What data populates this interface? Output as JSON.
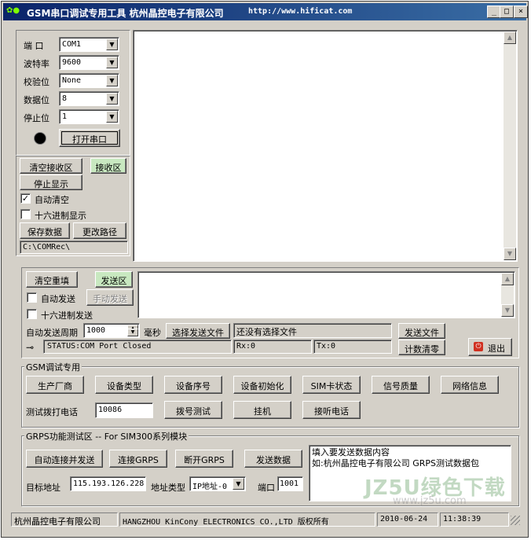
{
  "window": {
    "title": "GSM串口调试专用工具 杭州晶控电子有限公司",
    "title_url": "http://www.hificat.com",
    "minimize": "_",
    "maximize": "□",
    "close": "×"
  },
  "port": {
    "port_label": "端  口",
    "port_value": "COM1",
    "baud_label": "波特率",
    "baud_value": "9600",
    "parity_label": "校验位",
    "parity_value": "None",
    "databits_label": "数据位",
    "databits_value": "8",
    "stopbits_label": "停止位",
    "stopbits_value": "1",
    "open_button": "打开串口"
  },
  "receive": {
    "clear_button": "清空接收区",
    "area_button": "接收区",
    "stop_display_button": "停止显示",
    "auto_clear_label": "自动清空",
    "auto_clear_checked": true,
    "hex_display_label": "十六进制显示",
    "hex_display_checked": false,
    "save_button": "保存数据",
    "change_path_button": "更改路径",
    "path_value": "C:\\COMRec\\",
    "content": ""
  },
  "send": {
    "clear_button": "清空重填",
    "area_button": "发送区",
    "auto_send_label": "自动发送",
    "auto_send_checked": false,
    "manual_send_button": "手动发送",
    "hex_send_label": "十六进制发送",
    "hex_send_checked": false,
    "period_label": "自动发送周期",
    "period_value": "1000",
    "period_unit": "毫秒",
    "choose_file_button": "选择发送文件",
    "file_status": "还没有选择文件",
    "send_file_button": "发送文件",
    "status_text": "STATUS:COM Port Closed",
    "rx_text": "Rx:0",
    "tx_text": "Tx:0",
    "reset_count_button": "计数清零",
    "exit_button": "退出",
    "content": ""
  },
  "gsm": {
    "group_title": "GSM调试专用",
    "buttons": [
      "生产厂商",
      "设备类型",
      "设备序号",
      "设备初始化",
      "SIM卡状态",
      "信号质量",
      "网络信息"
    ],
    "dial_label": "测试拨打电话",
    "dial_value": "10086",
    "dial_button": "拨号测试",
    "hangup_button": "挂机",
    "answer_button": "接听电话"
  },
  "gprs": {
    "group_title": "GRPS功能测试区 -- For SIM300系列模块",
    "auto_connect_button": "自动连接并发送",
    "connect_button": "连接GRPS",
    "disconnect_button": "断开GRPS",
    "send_data_button": "发送数据",
    "target_label": "目标地址",
    "target_value": "115.193.126.228",
    "addr_type_label": "地址类型",
    "addr_type_value": "IP地址-0",
    "port_label": "端口",
    "port_value": "1001",
    "data_line1": "填入要发送数据内容",
    "data_line2": "如:杭州晶控电子有限公司  GRPS测试数据包"
  },
  "statusbar": {
    "company": "杭州晶控电子有限公司",
    "copyright": "HANGZHOU KinCony ELECTRONICS CO.,LTD 版权所有",
    "date": "2010-06-24",
    "time": "11:38:39"
  },
  "watermark": {
    "brand": "JZ5U绿色下载",
    "url": "www.jz5u.com"
  }
}
